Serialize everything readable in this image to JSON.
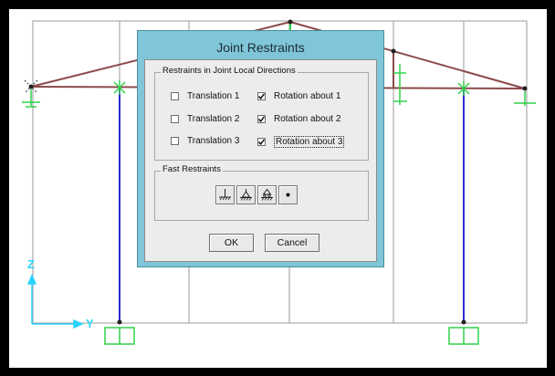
{
  "dialog": {
    "title": "Joint Restraints",
    "local_group": {
      "title": "Restraints in Joint Local Directions",
      "items": [
        {
          "label": "Translation 1",
          "checked": false
        },
        {
          "label": "Translation 2",
          "checked": false
        },
        {
          "label": "Translation 3",
          "checked": false
        },
        {
          "label": "Rotation about  1",
          "checked": true
        },
        {
          "label": "Rotation about  2",
          "checked": true
        },
        {
          "label": "Rotation about  3",
          "checked": true
        }
      ]
    },
    "fast_group": {
      "title": "Fast Restraints",
      "buttons": [
        "fixed-support-icon",
        "pinned-support-icon",
        "roller-support-icon",
        "free-joint-icon"
      ]
    },
    "ok_label": "OK",
    "cancel_label": "Cancel"
  },
  "axes": {
    "vertical": "Z",
    "horizontal": "Y"
  },
  "colors": {
    "frame": "#8b4a4a",
    "column": "#2a2ad8",
    "support": "#2fd24a",
    "axis": "#2ad4ff",
    "dialog_frame": "#7ec6d8"
  }
}
